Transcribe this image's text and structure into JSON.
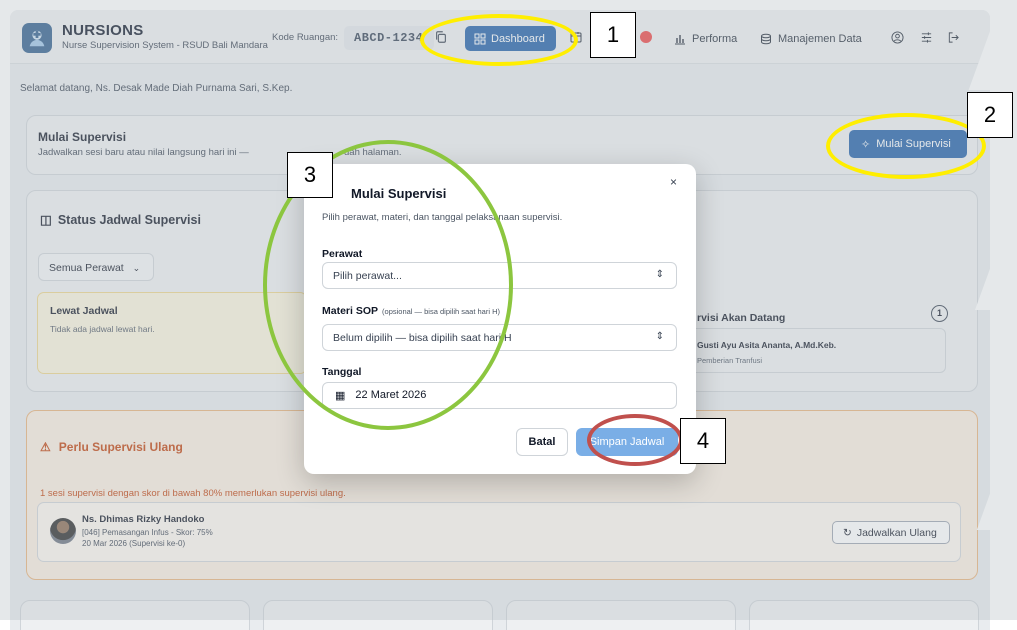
{
  "header": {
    "brand_title": "NURSIONS",
    "brand_subtitle": "Nurse Supervision System - RSUD Bali Mandara",
    "kode_label": "Kode Ruangan:",
    "kode_value": "ABCD-1234",
    "nav": {
      "dashboard": "Dashboard",
      "performa": "Performa",
      "manajemen": "Manajemen Data"
    }
  },
  "welcome": "Selamat datang, Ns. Desak Made Diah Purnama Sari, S.Kep.",
  "mulai": {
    "title": "Mulai Supervisi",
    "desc_left": "Jadwalkan sesi baru atau nilai langsung hari ini —",
    "desc_right": "dah halaman.",
    "button": "Mulai Supervisi"
  },
  "status": {
    "title": "Status Jadwal Supervisi",
    "filter": "Semua Perawat",
    "lewat_title": "Lewat Jadwal",
    "lewat_desc": "Tidak ada jadwal lewat hari.",
    "akan_title": "rvisi Akan Datang",
    "akan_count": "1",
    "akan_name": "Gusti Ayu Asita Ananta, A.Md.Keb.",
    "akan_sop": "Pemberian Tranfusi"
  },
  "ulang": {
    "title": "Perlu Supervisi Ulang",
    "desc": "1 sesi supervisi dengan skor di bawah 80% memerlukan supervisi ulang.",
    "name": "Ns. Dhimas Rizky Handoko",
    "detail": "[046] Pemasangan Infus - Skor: 75%",
    "date": "20 Mar 2026 (Supervisi ke-0)",
    "button": "Jadwalkan Ulang"
  },
  "modal": {
    "title": "Mulai Supervisi",
    "desc": "Pilih perawat, materi, dan tanggal pelaksanaan supervisi.",
    "perawat_label": "Perawat",
    "perawat_placeholder": "Pilih perawat...",
    "materi_label": "Materi SOP",
    "materi_hint": "(opsional — bisa dipilih saat hari H)",
    "materi_value": "Belum dipilih — bisa dipilih saat hari H",
    "tanggal_label": "Tanggal",
    "tanggal_value": "22 Maret 2026",
    "cancel": "Batal",
    "save": "Simpan Jadwal",
    "close": "×"
  },
  "annotations": [
    "1",
    "2",
    "3",
    "4"
  ],
  "colors": {
    "primary": "#1f5fa8",
    "warning_text": "#c2410c",
    "annot_yellow": "#ffee00",
    "annot_green": "#8cc63f",
    "annot_red": "#c0504d"
  }
}
